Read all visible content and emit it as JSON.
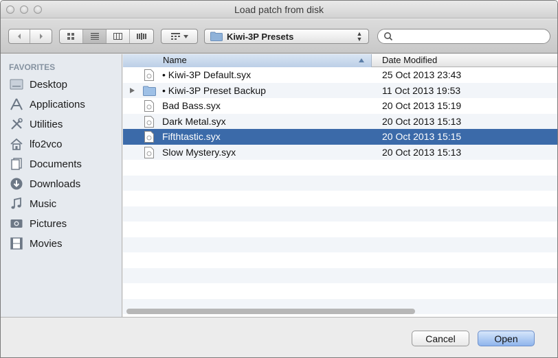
{
  "window": {
    "title": "Load patch from disk"
  },
  "toolbar": {
    "location": "Kiwi-3P Presets",
    "search_value": "",
    "nav_back_icon": "chevron-left-icon",
    "nav_forward_icon": "chevron-right-icon"
  },
  "sidebar": {
    "section": "FAVORITES",
    "items": [
      {
        "label": "Desktop",
        "icon": "desktop-icon"
      },
      {
        "label": "Applications",
        "icon": "applications-icon"
      },
      {
        "label": "Utilities",
        "icon": "utilities-icon"
      },
      {
        "label": "lfo2vco",
        "icon": "home-icon"
      },
      {
        "label": "Documents",
        "icon": "documents-icon"
      },
      {
        "label": "Downloads",
        "icon": "downloads-icon"
      },
      {
        "label": "Music",
        "icon": "music-icon"
      },
      {
        "label": "Pictures",
        "icon": "pictures-icon"
      },
      {
        "label": "Movies",
        "icon": "movies-icon"
      }
    ]
  },
  "list": {
    "columns": {
      "name": "Name",
      "date": "Date Modified"
    },
    "rows": [
      {
        "name": "• Kiwi-3P Default.syx",
        "date": "25 Oct 2013 23:43",
        "kind": "file"
      },
      {
        "name": "• Kiwi-3P Preset Backup",
        "date": "11 Oct 2013 19:53",
        "kind": "folder"
      },
      {
        "name": "Bad Bass.syx",
        "date": "20 Oct 2013 15:19",
        "kind": "file"
      },
      {
        "name": "Dark Metal.syx",
        "date": "20 Oct 2013 15:13",
        "kind": "file"
      },
      {
        "name": "Fifthtastic.syx",
        "date": "20 Oct 2013 15:15",
        "kind": "file",
        "selected": true
      },
      {
        "name": "Slow Mystery.syx",
        "date": "20 Oct 2013 15:13",
        "kind": "file"
      }
    ]
  },
  "footer": {
    "cancel_label": "Cancel",
    "open_label": "Open"
  },
  "colors": {
    "selection": "#3b6aa9",
    "sidebar_bg": "#e6eaef",
    "section_header": "#8592a0"
  }
}
